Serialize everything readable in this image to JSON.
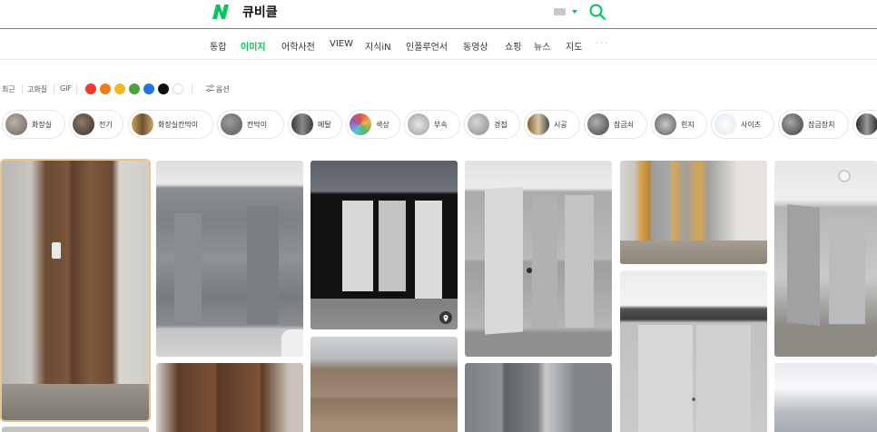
{
  "header": {
    "query": "큐비클",
    "logo_icon": "naver-n-logo-icon",
    "keyboard_icon": "keyboard-icon",
    "search_icon": "search-icon"
  },
  "tabs": [
    {
      "label": "통합",
      "active": false
    },
    {
      "label": "이미지",
      "active": true
    },
    {
      "label": "어학사전",
      "active": false
    },
    {
      "label": "VIEW",
      "active": false
    },
    {
      "label": "지식iN",
      "active": false
    },
    {
      "label": "인플루언서",
      "active": false
    },
    {
      "label": "동영상",
      "active": false
    },
    {
      "label": "쇼핑",
      "active": false
    },
    {
      "label": "뉴스",
      "active": false
    },
    {
      "label": "지도",
      "active": false
    },
    {
      "label": "···",
      "active": false
    }
  ],
  "filters": {
    "recent": "최근",
    "hd": "고화질",
    "gif": "GIF",
    "colors": [
      "#f23a2f",
      "#f07d1a",
      "#f3b81a",
      "#48a43c",
      "#2373e8",
      "#111111",
      "#ffffff"
    ],
    "options": "옵션"
  },
  "chips": [
    {
      "label": "화장실"
    },
    {
      "label": "전기"
    },
    {
      "label": "화장실칸막이"
    },
    {
      "label": "칸막이"
    },
    {
      "label": "메탈"
    },
    {
      "label": "색상"
    },
    {
      "label": "부속"
    },
    {
      "label": "경첩"
    },
    {
      "label": "시공"
    },
    {
      "label": "잠금쇠"
    },
    {
      "label": "힌지"
    },
    {
      "label": "사이즈"
    },
    {
      "label": "잠금장치"
    }
  ],
  "theme": {
    "accent": "#03c75a",
    "selected_outline": "#e8c48f"
  }
}
